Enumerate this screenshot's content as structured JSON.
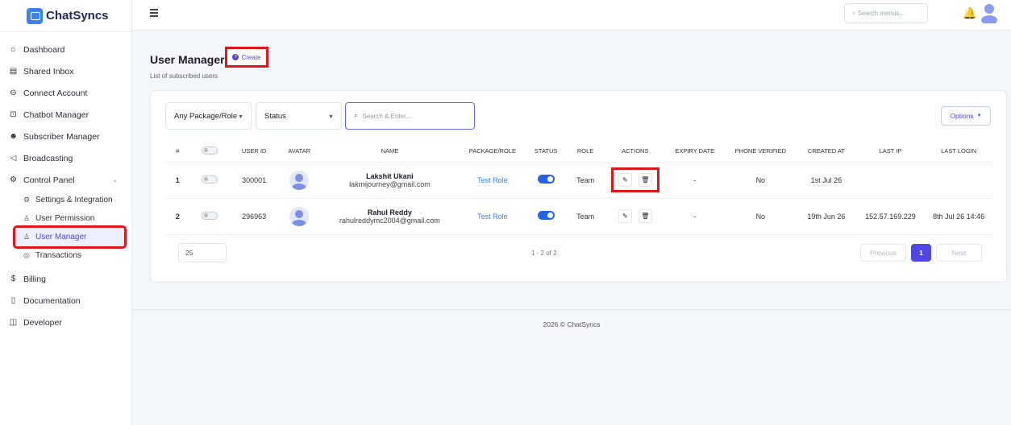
{
  "app": {
    "brand": "ChatSyncs"
  },
  "topbar": {
    "search_placeholder": "Search menus..."
  },
  "sidebar": {
    "items": [
      {
        "label": "Dashboard",
        "icon": "home-icon"
      },
      {
        "label": "Shared Inbox",
        "icon": "inbox-icon"
      },
      {
        "label": "Connect Account",
        "icon": "link-icon"
      },
      {
        "label": "Chatbot Manager",
        "icon": "bot-icon"
      },
      {
        "label": "Subscriber Manager",
        "icon": "users-icon"
      },
      {
        "label": "Broadcasting",
        "icon": "broadcast-icon"
      },
      {
        "label": "Control Panel",
        "icon": "gear-icon"
      }
    ],
    "sub_items": [
      {
        "label": "Settings & Integration"
      },
      {
        "label": "User Permission"
      },
      {
        "label": "User Manager"
      },
      {
        "label": "Transactions"
      }
    ],
    "bottom_items": [
      {
        "label": "Billing"
      },
      {
        "label": "Documentation"
      },
      {
        "label": "Developer"
      }
    ]
  },
  "page": {
    "title": "User Manager",
    "create_label": "Create",
    "subtitle": "List of subscribed users"
  },
  "filters": {
    "package_role": "Any Package/Role",
    "status": "Status",
    "search_placeholder": "Search & Enter...",
    "options_label": "Options"
  },
  "table": {
    "headers": [
      "#",
      "",
      "USER ID",
      "AVATAR",
      "NAME",
      "PACKAGE/ROLE",
      "STATUS",
      "ROLE",
      "ACTIONS",
      "EXPIRY DATE",
      "PHONE VERIFIED",
      "CREATED AT",
      "LAST IP",
      "LAST LOGIN"
    ],
    "rows": [
      {
        "num": "1",
        "user_id": "300001",
        "name": "Lakshit Ukani",
        "email": "lakmijourney@gmail.com",
        "package": "Test Role",
        "status": "on",
        "role": "Team",
        "expiry": "-",
        "phone_verified": "No",
        "created": "1st Jul 26",
        "last_ip": "",
        "last_login": ""
      },
      {
        "num": "2",
        "user_id": "296963",
        "name": "Rahul Reddy",
        "email": "rahulreddymc2004@gmail.com",
        "package": "Test Role",
        "status": "on",
        "role": "Team",
        "expiry": "-",
        "phone_verified": "No",
        "created": "19th Jun 26",
        "last_ip": "152.57.169.229",
        "last_login": "8th Jul 26 14:46"
      }
    ]
  },
  "pagination": {
    "page_size": "25",
    "count": "1 - 2 of 2",
    "previous": "Previous",
    "current": "1",
    "next": "Next"
  },
  "footer": {
    "text": "2026 © ChatSyncs"
  },
  "colors": {
    "accent": "#4f46e5",
    "highlight": "#e0161b",
    "toggle_on": "#2563eb"
  }
}
